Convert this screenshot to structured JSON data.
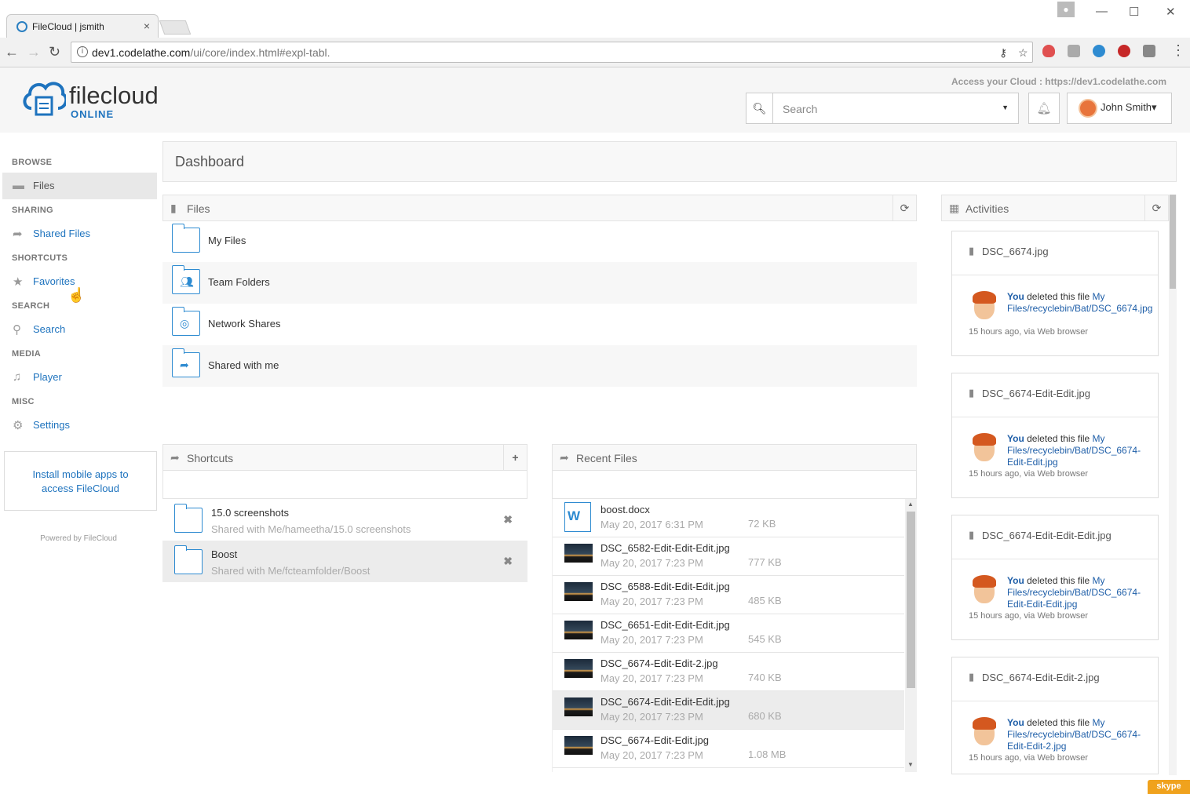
{
  "browser": {
    "tab_title": "FileCloud | jsmith",
    "tab_close": "×",
    "url_host": "dev1.codelathe.com",
    "url_path": "/ui/core/index.html#expl-tabl.",
    "window_controls": {
      "minimize": "—",
      "maximize": "☐",
      "close": "✕"
    }
  },
  "header": {
    "logo_word": "filecloud",
    "logo_sub": "ONLINE",
    "access_text": "Access your Cloud : https://dev1.codelathe.com",
    "search_placeholder": "Search",
    "user_name": "John Smith"
  },
  "sidebar": {
    "sections": [
      {
        "title": "BROWSE",
        "items": [
          {
            "label": "Files",
            "icon": "folder-icon",
            "active": true
          }
        ]
      },
      {
        "title": "SHARING",
        "items": [
          {
            "label": "Shared Files",
            "icon": "share-icon"
          }
        ]
      },
      {
        "title": "SHORTCUTS",
        "items": [
          {
            "label": "Favorites",
            "icon": "star-icon"
          }
        ]
      },
      {
        "title": "SEARCH",
        "items": [
          {
            "label": "Search",
            "icon": "search-icon"
          }
        ]
      },
      {
        "title": "MEDIA",
        "items": [
          {
            "label": "Player",
            "icon": "music-icon"
          }
        ]
      },
      {
        "title": "MISC",
        "items": [
          {
            "label": "Settings",
            "icon": "gear-icon"
          }
        ]
      }
    ],
    "mobile_apps": "Install mobile apps to access FileCloud",
    "powered_by": "Powered by FileCloud"
  },
  "main": {
    "page_title": "Dashboard",
    "files_panel": {
      "title": "Files",
      "rows": [
        {
          "label": "My Files",
          "icon": "folder-icon"
        },
        {
          "label": "Team Folders",
          "icon": "team-folder-icon"
        },
        {
          "label": "Network Shares",
          "icon": "network-folder-icon"
        },
        {
          "label": "Shared with me",
          "icon": "shared-folder-icon"
        }
      ]
    },
    "shortcuts_panel": {
      "title": "Shortcuts",
      "rows": [
        {
          "name": "15.0 screenshots",
          "path": "Shared with Me/hameetha/15.0 screenshots"
        },
        {
          "name": "Boost",
          "path": "Shared with Me/fcteamfolder/Boost"
        }
      ]
    },
    "recent_panel": {
      "title": "Recent Files",
      "rows": [
        {
          "name": "boost.docx",
          "date": "May 20, 2017 6:31 PM",
          "size": "72 KB",
          "icon": "word-doc-icon"
        },
        {
          "name": "DSC_6582-Edit-Edit-Edit.jpg",
          "date": "May 20, 2017 7:23 PM",
          "size": "777 KB",
          "icon": "image-thumbnail"
        },
        {
          "name": "DSC_6588-Edit-Edit-Edit.jpg",
          "date": "May 20, 2017 7:23 PM",
          "size": "485 KB",
          "icon": "image-thumbnail"
        },
        {
          "name": "DSC_6651-Edit-Edit-Edit.jpg",
          "date": "May 20, 2017 7:23 PM",
          "size": "545 KB",
          "icon": "image-thumbnail"
        },
        {
          "name": "DSC_6674-Edit-Edit-2.jpg",
          "date": "May 20, 2017 7:23 PM",
          "size": "740 KB",
          "icon": "image-thumbnail"
        },
        {
          "name": "DSC_6674-Edit-Edit-Edit.jpg",
          "date": "May 20, 2017 7:23 PM",
          "size": "680 KB",
          "icon": "image-thumbnail"
        },
        {
          "name": "DSC_6674-Edit-Edit.jpg",
          "date": "May 20, 2017 7:23 PM",
          "size": "1.08 MB",
          "icon": "image-thumbnail"
        }
      ]
    },
    "activities_panel": {
      "title": "Activities",
      "cards": [
        {
          "file": "DSC_6674.jpg",
          "actor": "You",
          "action": "deleted this file",
          "link": "My Files/recyclebin/Bat/DSC_6674.jpg",
          "when": "15 hours ago, via Web browser"
        },
        {
          "file": "DSC_6674-Edit-Edit.jpg",
          "actor": "You",
          "action": "deleted this file",
          "link": "My Files/recyclebin/Bat/DSC_6674-Edit-Edit.jpg",
          "when": "15 hours ago, via Web browser"
        },
        {
          "file": "DSC_6674-Edit-Edit-Edit.jpg",
          "actor": "You",
          "action": "deleted this file",
          "link": "My Files/recyclebin/Bat/DSC_6674-Edit-Edit-Edit.jpg",
          "when": "15 hours ago, via Web browser"
        },
        {
          "file": "DSC_6674-Edit-Edit-2.jpg",
          "actor": "You",
          "action": "deleted this file",
          "link": "My Files/recyclebin/Bat/DSC_6674-Edit-Edit-2.jpg",
          "when": "15 hours ago, via Web browser"
        }
      ]
    }
  },
  "tray": {
    "skype": "skype"
  },
  "colors": {
    "accent": "#1e73be",
    "folder_blue": "#2e8bd1"
  }
}
